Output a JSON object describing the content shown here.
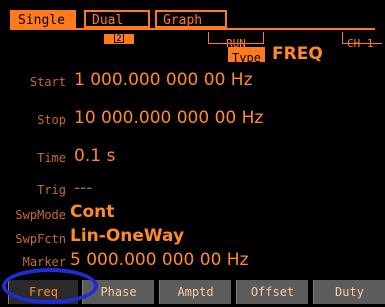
{
  "tabs": [
    {
      "label": "Single",
      "active": true
    },
    {
      "label": "Dual",
      "active": false
    },
    {
      "label": "Graph",
      "active": false
    }
  ],
  "status": {
    "channel_marker": "2",
    "run": "RUN",
    "channel": "CH 1",
    "type_label": "Type",
    "type_value": "FREQ"
  },
  "params": [
    {
      "label": "Start",
      "value": "1 000.000 000 00 Hz"
    },
    {
      "label": "Stop",
      "value": "10 000.000 000 00 Hz"
    },
    {
      "label": "Time",
      "value": "0.1 s"
    },
    {
      "label": "Trig",
      "value": "---"
    },
    {
      "label": "SwpMode",
      "value": "Cont"
    },
    {
      "label": "SwpFctn",
      "value": "Lin-OneWay"
    },
    {
      "label": "Marker",
      "value": "5 000.000 000 00 Hz"
    }
  ],
  "softkeys": [
    {
      "label": "Freq",
      "active": true
    },
    {
      "label": "Phase",
      "active": false
    },
    {
      "label": "Amptd",
      "active": false
    },
    {
      "label": "Offset",
      "active": false
    },
    {
      "label": "Duty",
      "active": false
    }
  ],
  "colors": {
    "accent": "#ff7a1a",
    "highlight_circle": "#1e2bd6"
  }
}
